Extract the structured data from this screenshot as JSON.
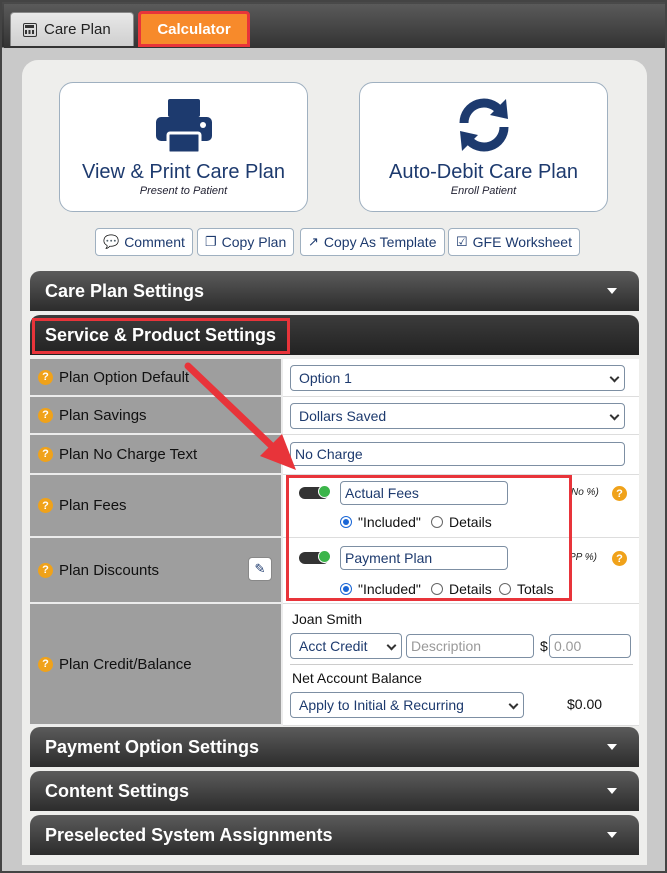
{
  "tabs": {
    "care_plan": "Care Plan",
    "calculator": "Calculator"
  },
  "actions": {
    "view_print": {
      "title": "View & Print Care Plan",
      "subtitle": "Present to Patient",
      "icon": "printer-icon"
    },
    "auto_debit": {
      "title": "Auto-Debit Care Plan",
      "subtitle": "Enroll Patient",
      "icon": "refresh-icon"
    }
  },
  "toolbar": {
    "comment": "Comment",
    "copy_plan": "Copy Plan",
    "copy_template": "Copy As Template",
    "gfe": "GFE Worksheet"
  },
  "sections": {
    "care_plan_settings": "Care Plan Settings",
    "service_product": "Service & Product Settings",
    "payment_option": "Payment Option Settings",
    "content": "Content Settings",
    "preselected": "Preselected System Assignments"
  },
  "rows": {
    "plan_option_default": {
      "label": "Plan Option Default",
      "value": "Option 1"
    },
    "plan_savings": {
      "label": "Plan Savings",
      "value": "Dollars Saved"
    },
    "plan_no_charge": {
      "label": "Plan No Charge Text",
      "value": "No Charge"
    },
    "plan_fees": {
      "label": "Plan Fees",
      "input": "Actual Fees",
      "note": "No %)",
      "radio_included": "\"Included\"",
      "radio_details": "Details"
    },
    "plan_discounts": {
      "label": "Plan Discounts",
      "input": "Payment Plan",
      "note": "PP %)",
      "radio_included": "\"Included\"",
      "radio_details": "Details",
      "radio_totals": "Totals"
    },
    "plan_credit": {
      "label": "Plan Credit/Balance",
      "patient_name": "Joan Smith",
      "credit_type": "Acct Credit",
      "description_placeholder": "Description",
      "currency": "$",
      "amount_placeholder": "0.00",
      "net_label": "Net Account Balance",
      "apply_to": "Apply to Initial & Recurring",
      "net_amount": "$0.00"
    }
  },
  "colors": {
    "accent_orange": "#f78a2b",
    "highlight_red": "#e8343a",
    "brand_navy": "#1d3a6e",
    "toggle_green": "#3bb54a"
  }
}
